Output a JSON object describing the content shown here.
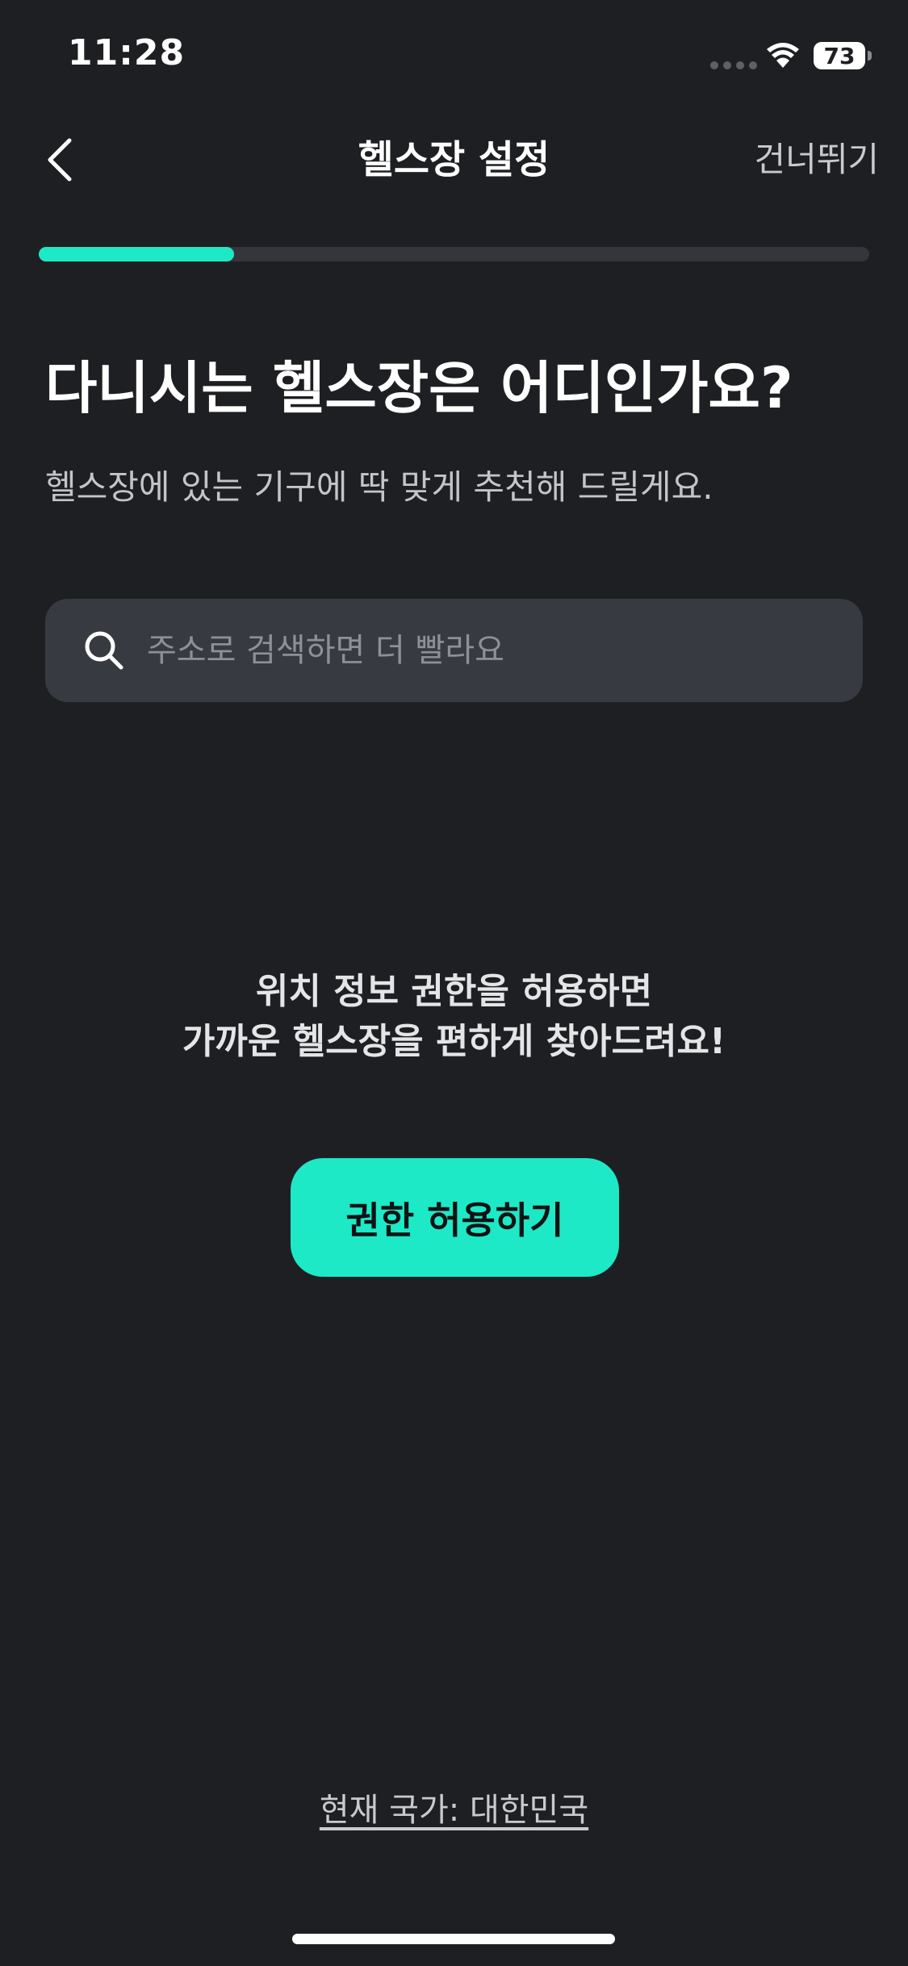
{
  "status_bar": {
    "time": "11:28",
    "battery": "73"
  },
  "header": {
    "title": "헬스장 설정",
    "skip_label": "건너뛰기"
  },
  "progress": {
    "value_percent": 23.5,
    "fill_color": "#1de9c6"
  },
  "main": {
    "question": "다니시는 헬스장은 어디인가요?",
    "subtitle": "헬스장에 있는 기구에 딱 맞게 추천해 드릴게요."
  },
  "search": {
    "placeholder": "주소로 검색하면 더 빨라요",
    "value": ""
  },
  "permission": {
    "message_line1": "위치 정보 권한을 허용하면",
    "message_line2": "가까운 헬스장을 편하게 찾아드려요!",
    "button_label": "권한 허용하기"
  },
  "footer": {
    "country_label": "현재 국가: 대한민국"
  },
  "colors": {
    "background": "#1e1f22",
    "accent": "#1de9c6",
    "surface": "#383a42"
  }
}
